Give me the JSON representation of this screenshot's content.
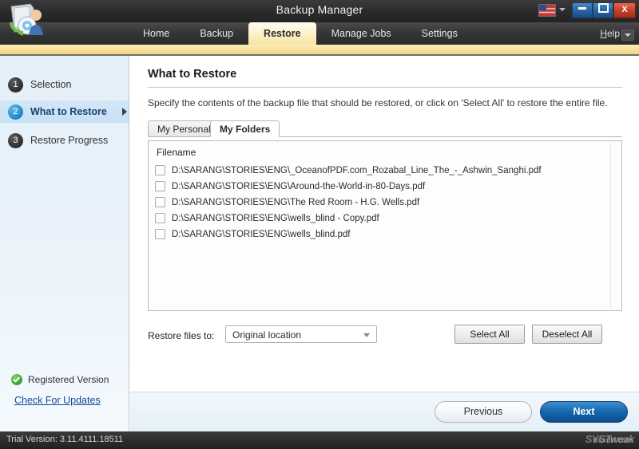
{
  "window": {
    "title": "Backup Manager",
    "icon": "backup-manager-app-icon",
    "language_flag": "us-flag-icon",
    "minimize_label": "",
    "maximize_label": "",
    "close_label": "X"
  },
  "navbar": {
    "tabs": [
      {
        "label": "Home",
        "active": false
      },
      {
        "label": "Backup",
        "active": false
      },
      {
        "label": "Restore",
        "active": true
      },
      {
        "label": "Manage Jobs",
        "active": false
      },
      {
        "label": "Settings",
        "active": false
      }
    ],
    "help_label": "Help"
  },
  "sidebar": {
    "steps": [
      {
        "number": "1",
        "label": "Selection",
        "active": false
      },
      {
        "number": "2",
        "label": "What to Restore",
        "active": true
      },
      {
        "number": "3",
        "label": "Restore Progress",
        "active": false
      }
    ],
    "registered_label": "Registered Version",
    "updates_link": "Check For Updates"
  },
  "main": {
    "title": "What to Restore",
    "description": "Specify the contents of the backup file that should be restored, or click on 'Select All' to restore the entire file.",
    "tabs": [
      {
        "label": "My Personal",
        "active": false
      },
      {
        "label": "My Folders",
        "active": true
      }
    ],
    "filelist": {
      "column_header": "Filename",
      "rows": [
        {
          "name": "D:\\SARANG\\STORIES\\ENG\\_OceanofPDF.com_Rozabal_Line_The_-_Ashwin_Sanghi.pdf",
          "checked": false
        },
        {
          "name": "D:\\SARANG\\STORIES\\ENG\\Around-the-World-in-80-Days.pdf",
          "checked": false
        },
        {
          "name": "D:\\SARANG\\STORIES\\ENG\\The Red Room - H.G. Wells.pdf",
          "checked": false
        },
        {
          "name": "D:\\SARANG\\STORIES\\ENG\\wells_blind - Copy.pdf",
          "checked": false
        },
        {
          "name": "D:\\SARANG\\STORIES\\ENG\\wells_blind.pdf",
          "checked": false
        }
      ]
    },
    "restore_to_label": "Restore files to:",
    "restore_to_value": "Original location",
    "restore_to_options": [
      "Original location"
    ],
    "select_all_label": "Select All",
    "deselect_all_label": "Deselect All"
  },
  "footer": {
    "previous_label": "Previous",
    "next_label": "Next"
  },
  "statusbar": {
    "trial_text": "Trial Version: 3.11.4111.18511",
    "watermark": "SYSTweak",
    "watermark2": "wsxdn.com"
  },
  "colors": {
    "accent_blue": "#1567ae",
    "tab_highlight": "#fdf0c6",
    "sidebar_bg": "#e4f0f9",
    "title_dark": "#2a2a2a"
  }
}
